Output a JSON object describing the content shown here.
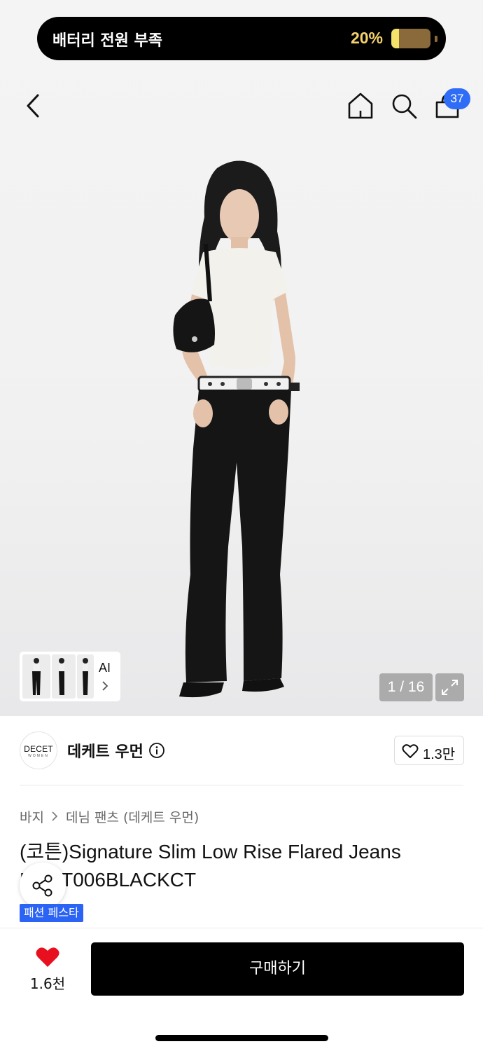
{
  "status": {
    "battery_message": "배터리 전원 부족",
    "battery_percent": "20%",
    "battery_level": 0.2
  },
  "header": {
    "back_icon": "chevron-left-icon",
    "home_icon": "home-icon",
    "search_icon": "search-icon",
    "cart_icon": "shopping-bag-icon",
    "cart_count": "37"
  },
  "gallery": {
    "ai_label": "AI",
    "counter": "1 / 16",
    "expand_icon": "expand-icon"
  },
  "brand": {
    "logo_text": "DECET",
    "logo_subtext": "WOMEN",
    "name": "데케트 우먼",
    "info_icon": "info-icon",
    "like_count": "1.3만"
  },
  "breadcrumb": {
    "level1": "바지",
    "level2": "데님 팬츠 (데케트 우먼)"
  },
  "product": {
    "title": "(코튼)Signature Slim Low Rise Flared Jeans DECT006BLACKCT",
    "badge": "패션 페스타"
  },
  "bottom_bar": {
    "wish_count": "1.6천",
    "buy_label": "구매하기"
  },
  "colors": {
    "accent_blue": "#2f6df6",
    "heart_red": "#e8101f",
    "buy_button": "#000000"
  }
}
